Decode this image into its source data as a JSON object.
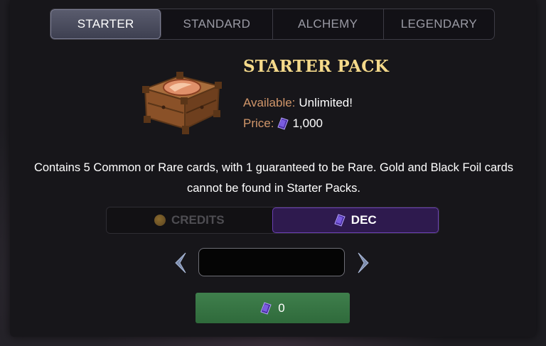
{
  "tabs": [
    {
      "label": "STARTER",
      "active": true
    },
    {
      "label": "STANDARD",
      "active": false
    },
    {
      "label": "ALCHEMY",
      "active": false
    },
    {
      "label": "LEGENDARY",
      "active": false
    }
  ],
  "pack": {
    "title": "STARTER PACK",
    "available_label": "Available:",
    "available_value": "Unlimited!",
    "price_label": "Price:",
    "price_value": "1,000",
    "price_currency_icon": "dec-gem-icon",
    "image": "starter-pack-chest"
  },
  "description": "Contains 5 Common or Rare cards, with 1 guaranteed to be Rare. Gold and Black Foil cards cannot be found in Starter Packs.",
  "currency": {
    "credits_label": "CREDITS",
    "dec_label": "DEC",
    "selected": "DEC"
  },
  "quantity": {
    "value": "",
    "placeholder": ""
  },
  "buy": {
    "amount": "0",
    "icon": "dec-gem-icon",
    "color": "#3f7f4c"
  },
  "colors": {
    "accent_gold": "#f4d98a",
    "label_orange": "#d1966a",
    "dec_purple": "#6b3fb3"
  }
}
